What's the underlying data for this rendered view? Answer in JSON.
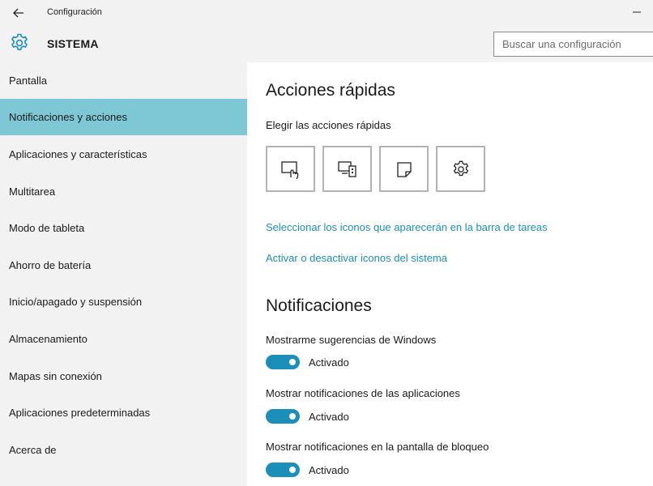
{
  "titlebar": {
    "title": "Configuración"
  },
  "header": {
    "section_title": "SISTEMA",
    "search_placeholder": "Buscar una configuración"
  },
  "sidebar": {
    "items": [
      {
        "label": "Pantalla",
        "selected": false
      },
      {
        "label": "Notificaciones y acciones",
        "selected": true
      },
      {
        "label": "Aplicaciones y características",
        "selected": false
      },
      {
        "label": "Multitarea",
        "selected": false
      },
      {
        "label": "Modo de tableta",
        "selected": false
      },
      {
        "label": "Ahorro de batería",
        "selected": false
      },
      {
        "label": "Inicio/apagado y suspensión",
        "selected": false
      },
      {
        "label": "Almacenamiento",
        "selected": false
      },
      {
        "label": "Mapas sin conexión",
        "selected": false
      },
      {
        "label": "Aplicaciones predeterminadas",
        "selected": false
      },
      {
        "label": "Acerca de",
        "selected": false
      }
    ]
  },
  "main": {
    "quick_actions": {
      "heading": "Acciones rápidas",
      "subheading": "Elegir las acciones rápidas",
      "tiles": [
        {
          "icon": "tablet-mode-icon"
        },
        {
          "icon": "connect-icon"
        },
        {
          "icon": "note-icon"
        },
        {
          "icon": "settings-icon"
        }
      ],
      "link_taskbar_icons": "Seleccionar los iconos que aparecerán en la barra de tareas",
      "link_system_icons": "Activar o desactivar iconos del sistema"
    },
    "notifications": {
      "heading": "Notificaciones",
      "settings": [
        {
          "label": "Mostrarme sugerencias de Windows",
          "state": "Activado",
          "on": true
        },
        {
          "label": "Mostrar notificaciones de las aplicaciones",
          "state": "Activado",
          "on": true
        },
        {
          "label": "Mostrar notificaciones en la pantalla de bloqueo",
          "state": "Activado",
          "on": true
        }
      ]
    }
  },
  "colors": {
    "accent": "#1b8fba",
    "link": "#1a8fba",
    "selected_bg": "#7ec8d6",
    "chrome_bg": "#f2f2f2"
  }
}
